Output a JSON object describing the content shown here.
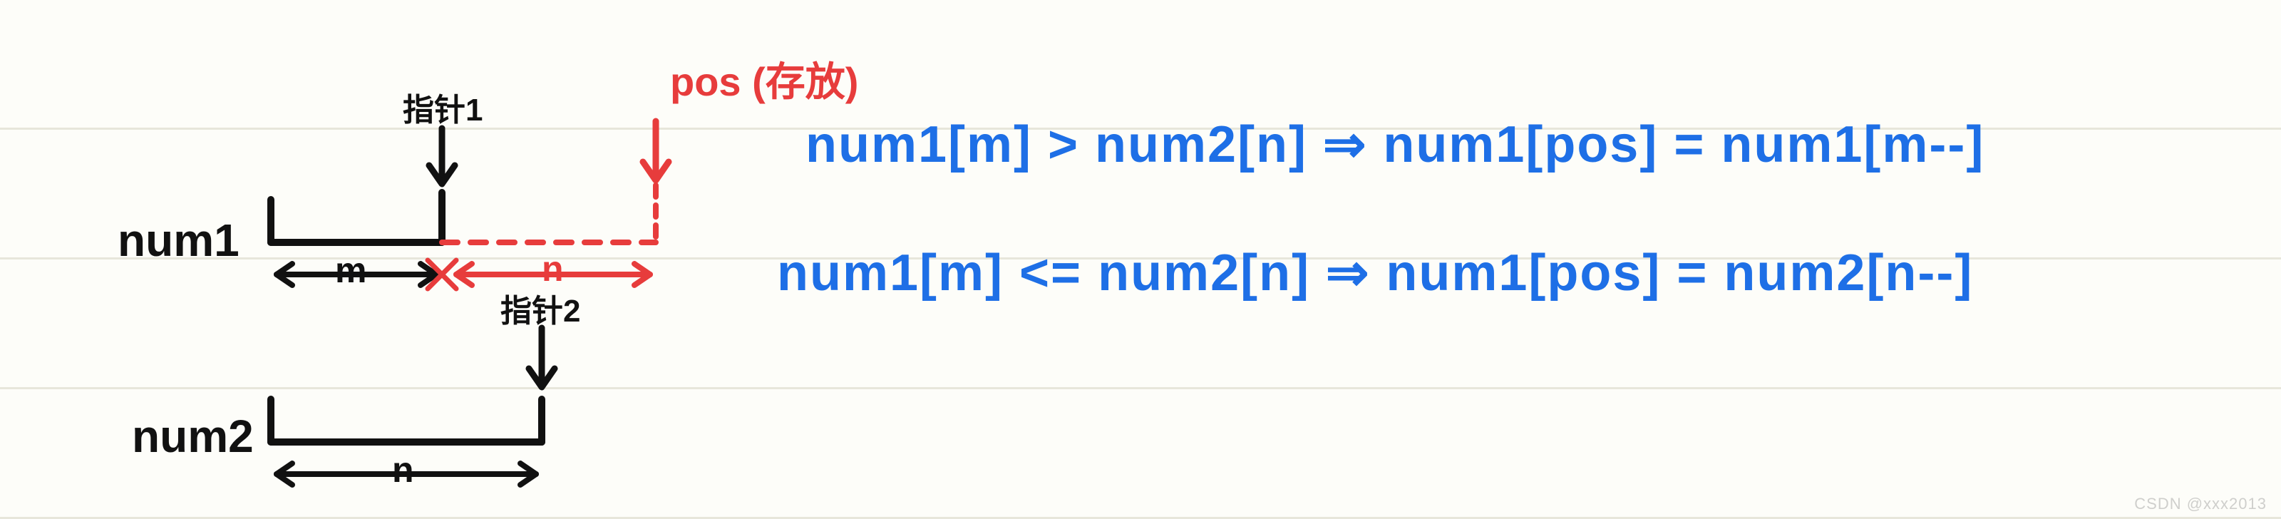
{
  "diagram": {
    "num1_label": "num1",
    "num2_label": "num2",
    "ptr1_label": "指针1",
    "ptr2_label": "指针2",
    "pos_label": "pos (存放)",
    "m_label": "m",
    "n_label_top": "n",
    "n_label_bottom": "n",
    "formula1": "num1[m] > num2[n]  ⇒  num1[pos] = num1[m--]",
    "formula2": "num1[m] <= num2[n] ⇒ num1[pos] = num2[n--]"
  },
  "watermark": "CSDN @xxx2013"
}
